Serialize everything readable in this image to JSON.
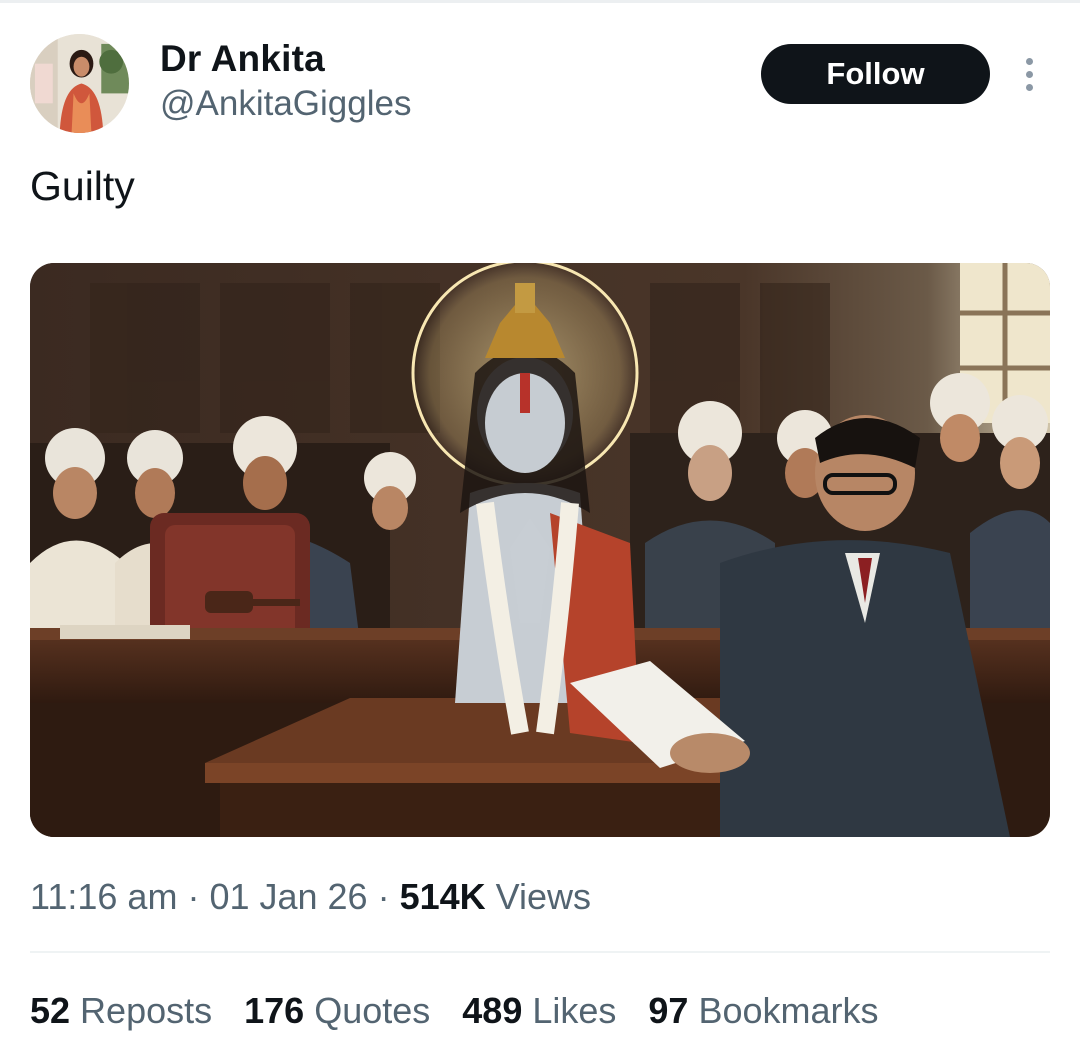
{
  "author": {
    "display_name": "Dr Ankita",
    "handle": "@AnkitaGiggles",
    "avatar_icon": "profile-photo"
  },
  "actions": {
    "follow_label": "Follow",
    "more_icon": "more-vertical-icon"
  },
  "tweet": {
    "text": "Guilty"
  },
  "meta": {
    "time": "11:16 am",
    "sep1": " · ",
    "date": "01 Jan 26",
    "sep2": " · ",
    "views_count": "514K",
    "views_label": " Views"
  },
  "stats": [
    {
      "count": "52",
      "label": " Reposts"
    },
    {
      "count": "176",
      "label": " Quotes"
    },
    {
      "count": "489",
      "label": " Likes"
    },
    {
      "count": "97",
      "label": " Bookmarks"
    }
  ],
  "colors": {
    "text_primary": "#0f1419",
    "text_secondary": "#536471",
    "follow_bg": "#0f1419",
    "divider": "#eff3f4"
  }
}
